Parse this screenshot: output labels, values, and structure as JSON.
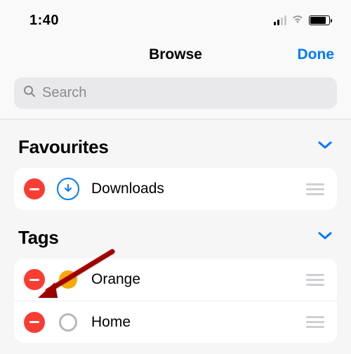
{
  "status": {
    "time": "1:40"
  },
  "nav": {
    "title": "Browse",
    "done": "Done"
  },
  "search": {
    "placeholder": "Search"
  },
  "sections": {
    "favourites": {
      "title": "Favourites",
      "items": [
        {
          "label": "Downloads"
        }
      ]
    },
    "tags": {
      "title": "Tags",
      "items": [
        {
          "label": "Orange",
          "color": "#f7a80c"
        },
        {
          "label": "Home"
        }
      ]
    }
  }
}
